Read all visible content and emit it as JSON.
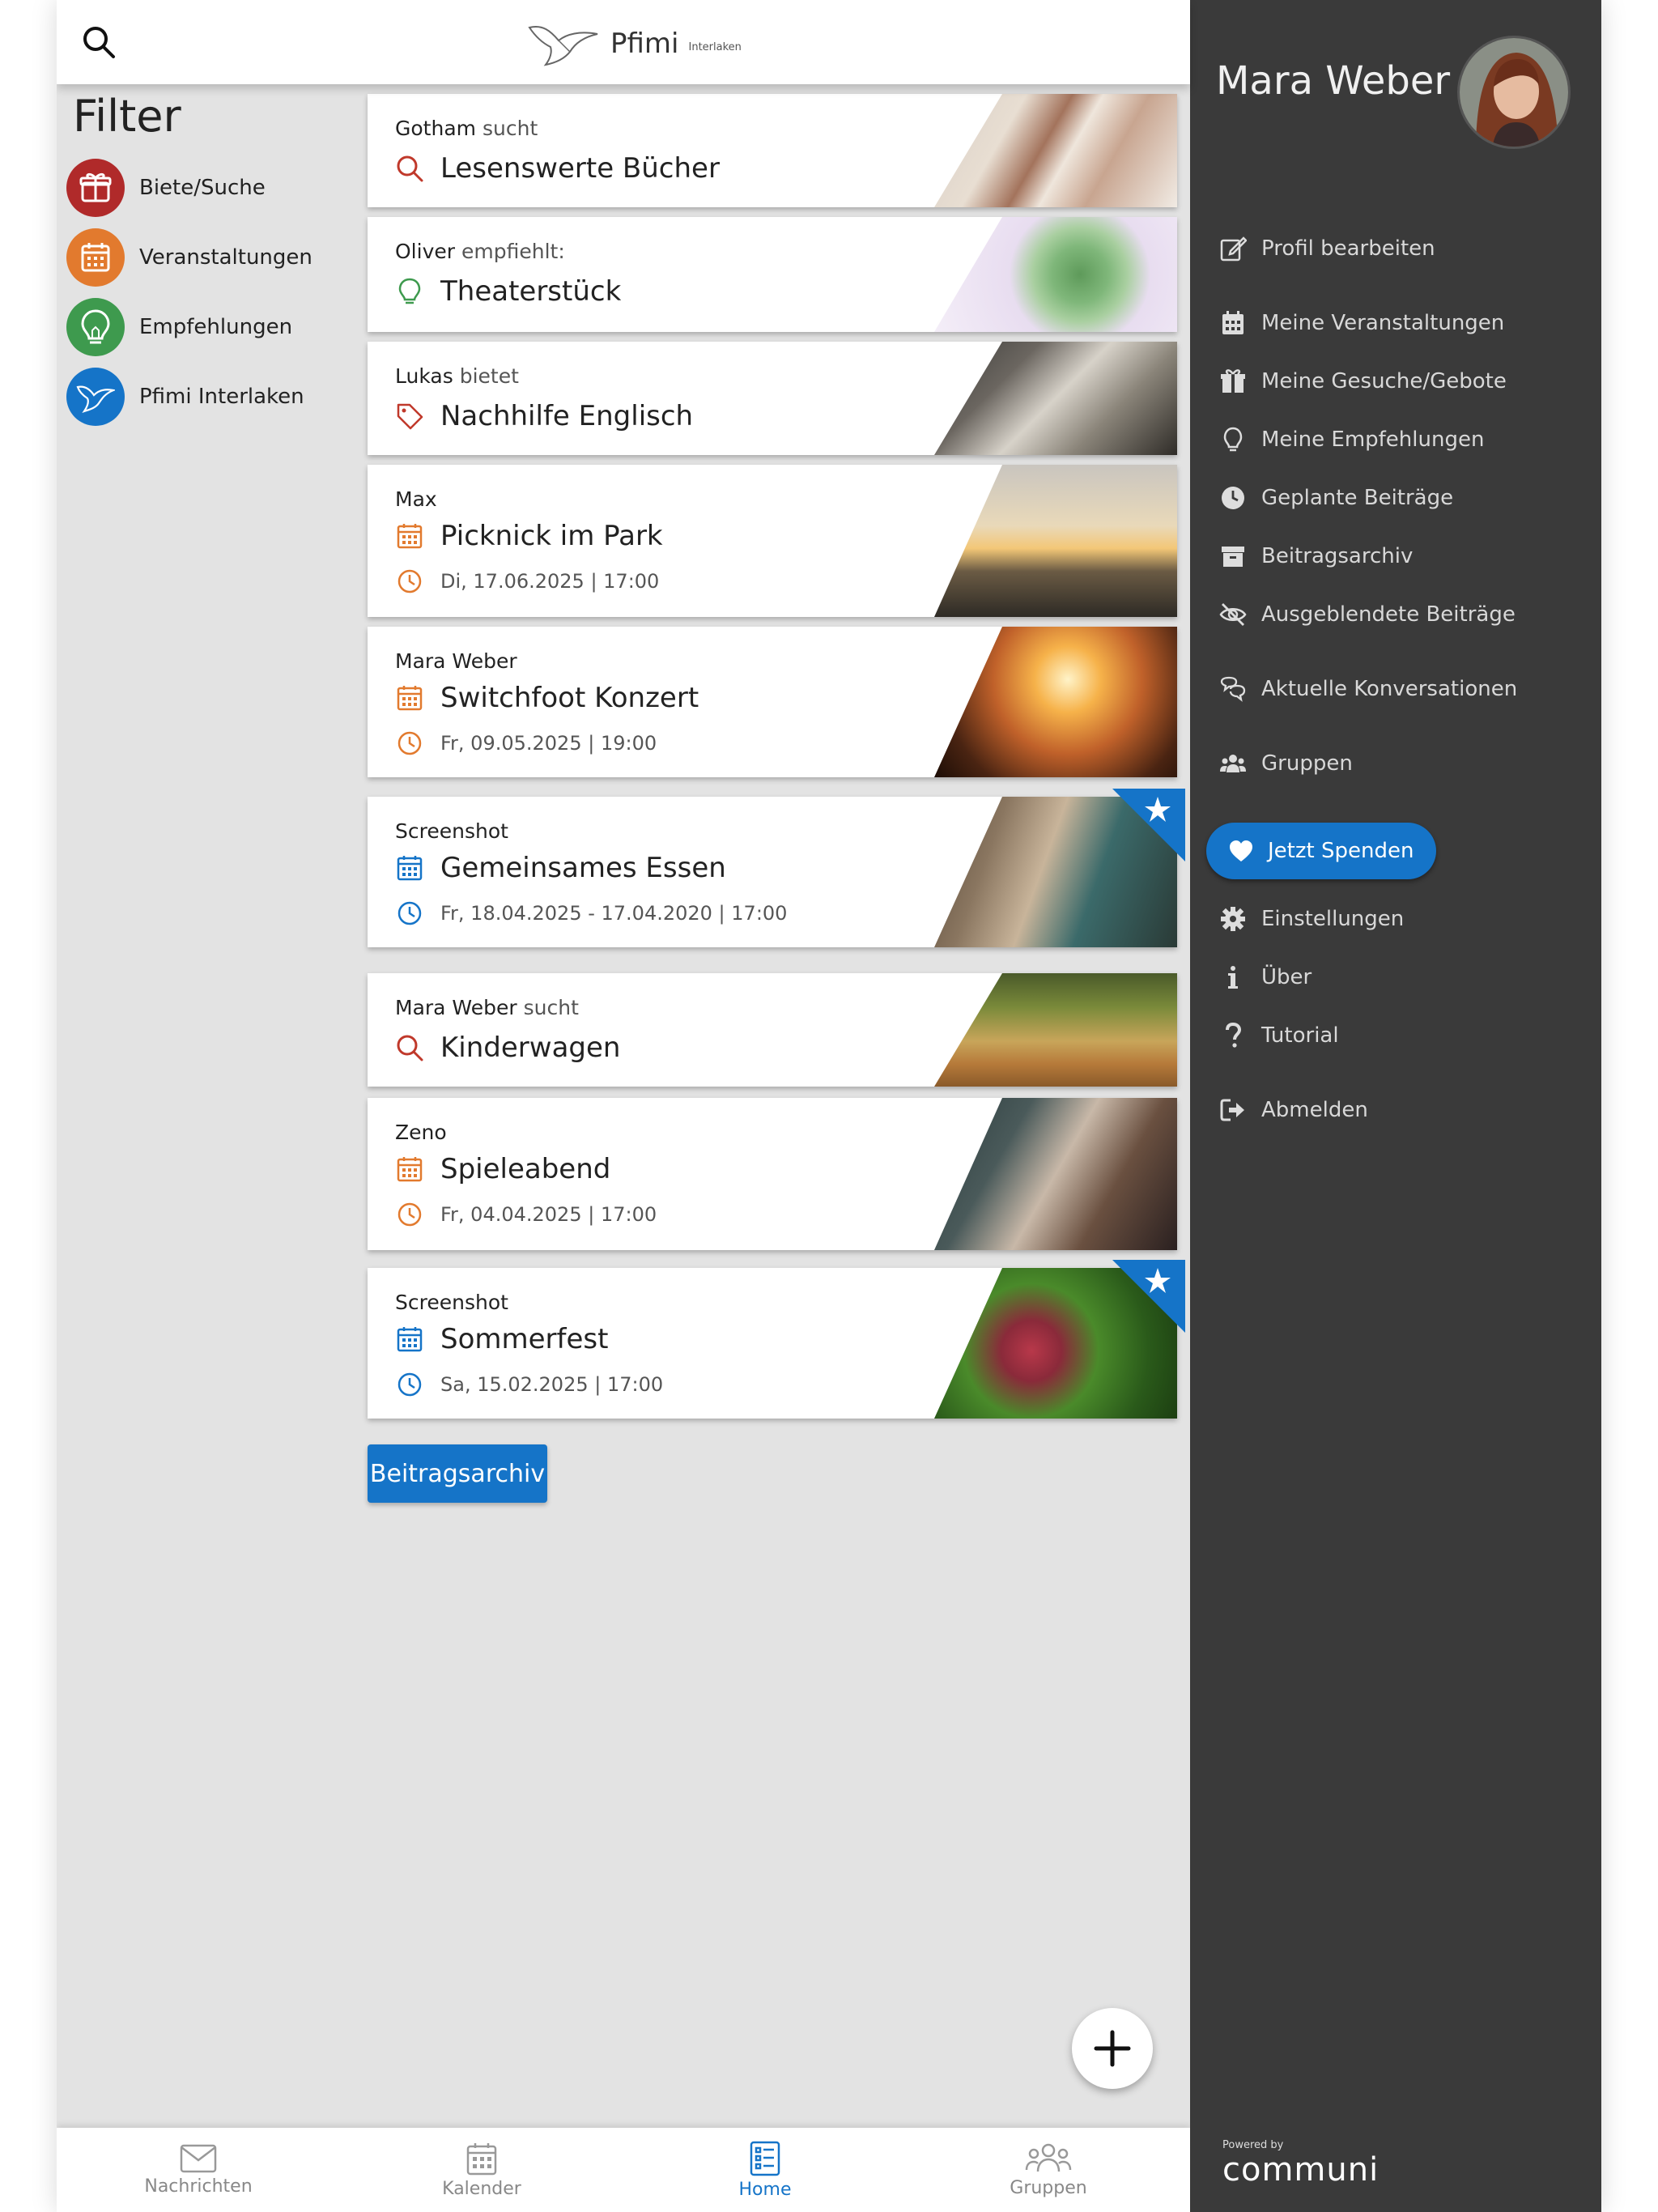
{
  "header": {
    "brand": "Pfimi",
    "brand_sub": "Interlaken"
  },
  "filter": {
    "title": "Filter",
    "items": [
      {
        "label": "Biete/Suche",
        "color": "#b02a2a",
        "icon": "gift-icon"
      },
      {
        "label": "Veranstaltungen",
        "color": "#e27a2e",
        "icon": "calendar-icon"
      },
      {
        "label": "Empfehlungen",
        "color": "#3e9a4e",
        "icon": "lightbulb-icon"
      },
      {
        "label": "Pfimi Interlaken",
        "color": "#1574c8",
        "icon": "dove-icon"
      }
    ]
  },
  "posts": [
    {
      "author": "Gotham",
      "verb": "sucht",
      "title": "Lesenswerte Bücher",
      "type": "search",
      "date": ""
    },
    {
      "author": "Oliver",
      "verb": "empfiehlt:",
      "title": "Theaterstück",
      "type": "recommend",
      "date": ""
    },
    {
      "author": "Lukas",
      "verb": "bietet",
      "title": "Nachhilfe Englisch",
      "type": "offer",
      "date": ""
    },
    {
      "author": "Max",
      "verb": "",
      "title": "Picknick im Park",
      "type": "event",
      "date": "Di, 17.06.2025 | 17:00"
    },
    {
      "author": "Mara Weber",
      "verb": "",
      "title": "Switchfoot Konzert",
      "type": "event",
      "date": "Fr, 09.05.2025 | 19:00"
    },
    {
      "author": "Screenshot",
      "verb": "",
      "title": "Gemeinsames Essen",
      "type": "event-blue",
      "date": "Fr, 18.04.2025 - 17.04.2020 | 17:00"
    },
    {
      "author": "Mara Weber",
      "verb": "sucht",
      "title": "Kinderwagen",
      "type": "search",
      "date": ""
    },
    {
      "author": "Zeno",
      "verb": "",
      "title": "Spieleabend",
      "type": "event",
      "date": "Fr, 04.04.2025 | 17:00"
    },
    {
      "author": "Screenshot",
      "verb": "",
      "title": "Sommerfest",
      "type": "event-blue",
      "date": "Sa, 15.02.2025 | 17:00"
    }
  ],
  "archive_button": "Beitragsarchiv",
  "bottom_nav": [
    {
      "label": "Nachrichten",
      "icon": "envelope-icon"
    },
    {
      "label": "Kalender",
      "icon": "calendar-icon"
    },
    {
      "label": "Home",
      "icon": "list-icon",
      "active": true
    },
    {
      "label": "Gruppen",
      "icon": "people-icon"
    }
  ],
  "drawer": {
    "user_name": "Mara Weber",
    "menu": [
      {
        "label": "Profil bearbeiten",
        "icon": "edit-icon"
      },
      {
        "label": "Meine Veranstaltungen",
        "icon": "calendar-icon"
      },
      {
        "label": "Meine Gesuche/Gebote",
        "icon": "gift-icon"
      },
      {
        "label": "Meine Empfehlungen",
        "icon": "lightbulb-icon"
      },
      {
        "label": "Geplante Beiträge",
        "icon": "clock-icon"
      },
      {
        "label": "Beitragsarchiv",
        "icon": "archive-icon"
      },
      {
        "label": "Ausgeblendete Beiträge",
        "icon": "eye-slash-icon"
      },
      {
        "label": "Aktuelle Konversationen",
        "icon": "chat-icon"
      },
      {
        "label": "Gruppen",
        "icon": "users-icon"
      },
      {
        "label": "Einstellungen",
        "icon": "gear-icon"
      },
      {
        "label": "Über",
        "icon": "info-icon"
      },
      {
        "label": "Tutorial",
        "icon": "question-icon"
      },
      {
        "label": "Abmelden",
        "icon": "logout-icon"
      }
    ],
    "donate_label": "Jetzt Spenden",
    "powered_by": "Powered by",
    "powered_brand": "communi"
  },
  "colors": {
    "accent": "#1574c8",
    "event": "#e27a2e",
    "search": "#c0392b",
    "recommend": "#3e9a4e",
    "drawer": "#3a3a3a"
  }
}
